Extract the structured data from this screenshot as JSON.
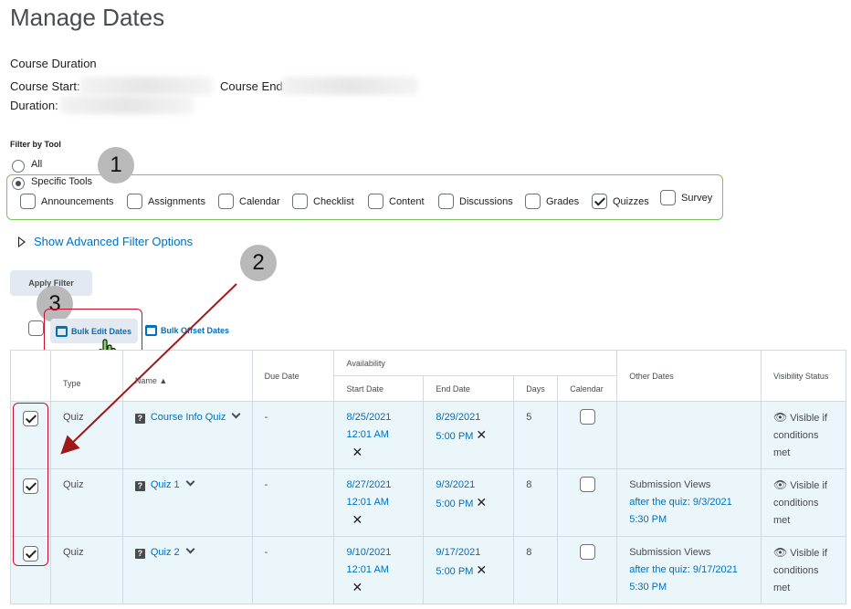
{
  "page": {
    "title": "Manage Dates"
  },
  "course": {
    "duration_label": "Course Duration",
    "start_label": "Course Start:",
    "end_label": "Course End",
    "duration_field_label": "Duration:"
  },
  "filter": {
    "label": "Filter by Tool",
    "all_label": "All",
    "specific_label": "Specific Tools",
    "tools": [
      {
        "label": "Announcements",
        "checked": false
      },
      {
        "label": "Assignments",
        "checked": false
      },
      {
        "label": "Calendar",
        "checked": false
      },
      {
        "label": "Checklist",
        "checked": false
      },
      {
        "label": "Content",
        "checked": false
      },
      {
        "label": "Discussions",
        "checked": false
      },
      {
        "label": "Grades",
        "checked": false
      },
      {
        "label": "Quizzes",
        "checked": true
      },
      {
        "label": "Survey",
        "checked": false
      }
    ],
    "advanced_label": "Show Advanced Filter Options",
    "apply_label": "Apply Filter"
  },
  "bulk": {
    "edit_label": "Bulk Edit Dates",
    "offset_label": "Bulk Offset Dates"
  },
  "callouts": [
    "1",
    "2",
    "3"
  ],
  "colors": {
    "link": "#006fbf",
    "highlight_green": "#78c850",
    "highlight_red": "#c8102e",
    "row_bg": "#ebf6fb"
  },
  "table": {
    "headers": {
      "type": "Type",
      "name": "Name",
      "due": "Due Date",
      "availability": "Availability",
      "start": "Start Date",
      "end": "End Date",
      "days": "Days",
      "calendar": "Calendar",
      "other": "Other Dates",
      "visibility": "Visibility Status"
    },
    "rows": [
      {
        "type": "Quiz",
        "name": "Course Info Quiz",
        "due": "-",
        "start_date": "8/25/2021",
        "start_time": "12:01 AM",
        "end_date": "8/29/2021",
        "end_time": "5:00 PM",
        "days": "5",
        "other_title": "",
        "other_link1": "",
        "other_link2": "",
        "visibility": [
          "Visible if",
          "conditions",
          "met"
        ]
      },
      {
        "type": "Quiz",
        "name": "Quiz 1",
        "due": "-",
        "start_date": "8/27/2021",
        "start_time": "12:01 AM",
        "end_date": "9/3/2021",
        "end_time": "5:00 PM",
        "days": "8",
        "other_title": "Submission Views",
        "other_link1": "after the quiz: 9/3/2021",
        "other_link2": "5:30 PM",
        "visibility": [
          "Visible if",
          "conditions",
          "met"
        ]
      },
      {
        "type": "Quiz",
        "name": "Quiz 2",
        "due": "-",
        "start_date": "9/10/2021",
        "start_time": "12:01 AM",
        "end_date": "9/17/2021",
        "end_time": "5:00 PM",
        "days": "8",
        "other_title": "Submission Views",
        "other_link1": "after the quiz: 9/17/2021",
        "other_link2": "5:30 PM",
        "visibility": [
          "Visible if",
          "conditions",
          "met"
        ]
      }
    ]
  }
}
